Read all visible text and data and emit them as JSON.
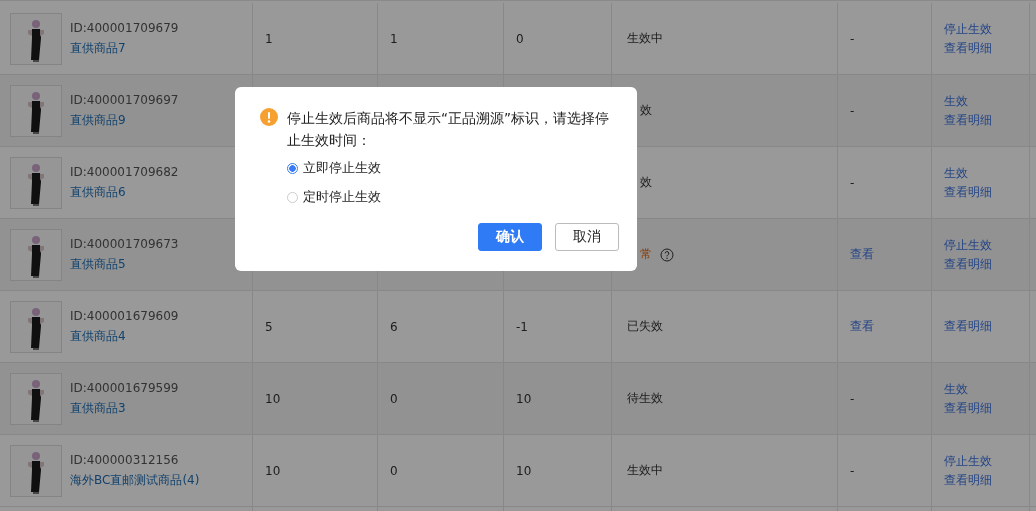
{
  "table": {
    "rows": [
      {
        "id": "ID:400001709679",
        "name": "直供商品7",
        "column_2": "1",
        "column_3": "1",
        "column_4": "0",
        "status": {
          "text": "生效中",
          "kind": "normal"
        },
        "column_6": {
          "text": "-",
          "kind": "plain"
        },
        "actions": [
          "停止生效",
          "查看明细"
        ]
      },
      {
        "id": "ID:400001709697",
        "name": "直供商品9",
        "status": {
          "text": "效",
          "kind": "normal",
          "covered_left": true
        },
        "column_6": {
          "text": "-",
          "kind": "plain"
        },
        "actions": [
          "生效",
          "查看明细"
        ]
      },
      {
        "id": "ID:400001709682",
        "name": "直供商品6",
        "status": {
          "text": "效",
          "kind": "normal",
          "covered_left": true
        },
        "column_6": {
          "text": "-",
          "kind": "plain"
        },
        "actions": [
          "生效",
          "查看明细"
        ]
      },
      {
        "id": "ID:400001709673",
        "name": "直供商品5",
        "status": {
          "text": "常",
          "kind": "warning",
          "covered_left": true
        },
        "column_6": {
          "text": "查看",
          "kind": "link"
        },
        "actions": [
          "停止生效",
          "查看明细"
        ]
      },
      {
        "id": "ID:400001679609",
        "name": "直供商品4",
        "column_2": "5",
        "column_3": "6",
        "column_4": "-1",
        "status": {
          "text": "已失效",
          "kind": "normal"
        },
        "column_6": {
          "text": "查看",
          "kind": "link"
        },
        "actions": [
          "查看明细"
        ]
      },
      {
        "id": "ID:400001679599",
        "name": "直供商品3",
        "column_2": "10",
        "column_3": "0",
        "column_4": "10",
        "status": {
          "text": "待生效",
          "kind": "normal"
        },
        "column_6": {
          "text": "-",
          "kind": "plain"
        },
        "actions": [
          "生效",
          "查看明细"
        ]
      },
      {
        "id": "ID:400000312156",
        "name": "海外BC直邮测试商品(4)",
        "column_2": "10",
        "column_3": "0",
        "column_4": "10",
        "status": {
          "text": "生效中",
          "kind": "normal"
        },
        "column_6": {
          "text": "-",
          "kind": "plain"
        },
        "actions": [
          "停止生效",
          "查看明细"
        ]
      }
    ]
  },
  "dialog": {
    "message": "停止生效后商品将不显示“正品溯源”标识，请选择停止生效时间：",
    "options": [
      {
        "label": "立即停止生效",
        "selected": true
      },
      {
        "label": "定时停止生效",
        "selected": false
      }
    ],
    "confirm": "确认",
    "cancel": "取消"
  }
}
